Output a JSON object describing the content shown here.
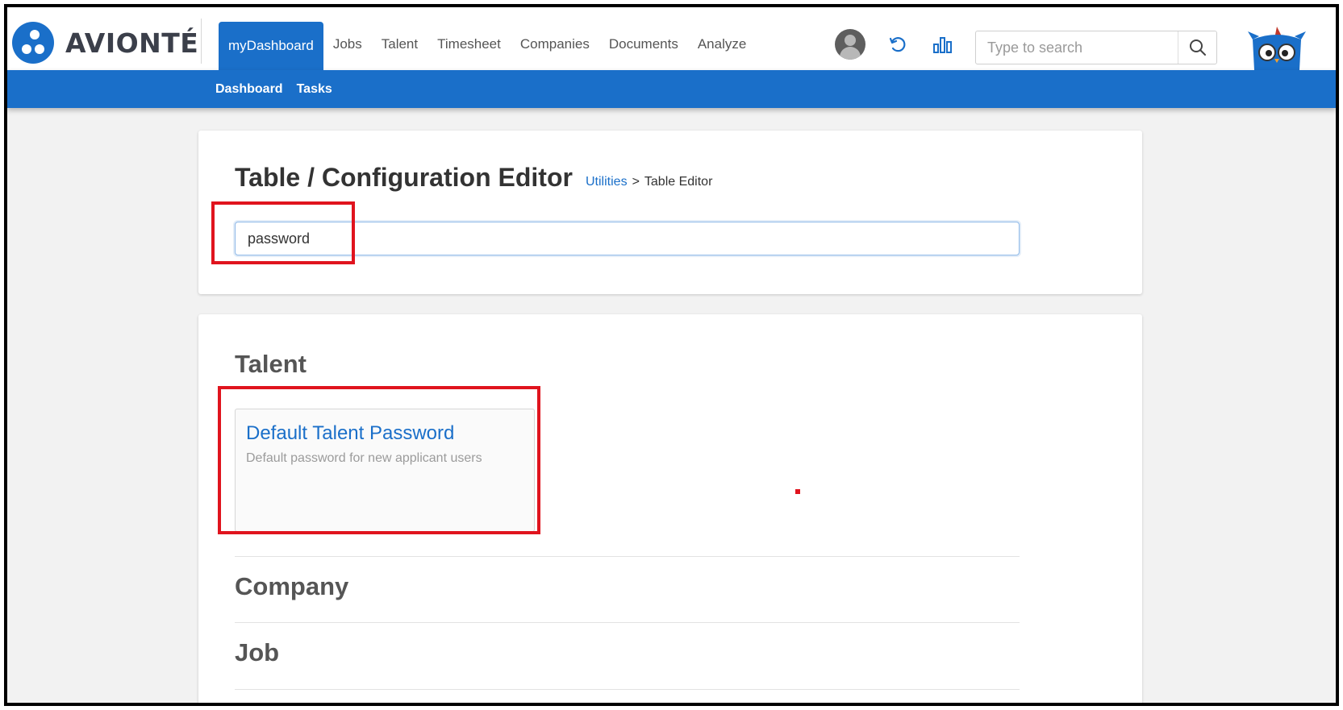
{
  "app": {
    "brand": "AVIONTÉ"
  },
  "nav": {
    "items": [
      {
        "label": "myDashboard",
        "active": true
      },
      {
        "label": "Jobs",
        "active": false
      },
      {
        "label": "Talent",
        "active": false
      },
      {
        "label": "Timesheet",
        "active": false
      },
      {
        "label": "Companies",
        "active": false
      },
      {
        "label": "Documents",
        "active": false
      },
      {
        "label": "Analyze",
        "active": false
      }
    ]
  },
  "header": {
    "search_placeholder": "Type to search",
    "icons": [
      "user-avatar-icon",
      "refresh-icon",
      "bar-chart-icon",
      "search-icon",
      "owl-mascot-icon"
    ]
  },
  "subnav": {
    "items": [
      "Dashboard",
      "Tasks"
    ]
  },
  "page": {
    "title": "Table / Configuration Editor",
    "breadcrumb": {
      "link": "Utilities",
      "separator": ">",
      "current": "Table Editor"
    },
    "filter_value": "password"
  },
  "results": {
    "sections": [
      {
        "name": "Talent",
        "items": [
          {
            "title": "Default Talent Password",
            "description": "Default password for new applicant users"
          }
        ]
      },
      {
        "name": "Company",
        "items": []
      },
      {
        "name": "Job",
        "items": []
      }
    ]
  },
  "colors": {
    "primary": "#1a6fc9",
    "annotation": "#e0141e",
    "background": "#f2f2f2"
  }
}
